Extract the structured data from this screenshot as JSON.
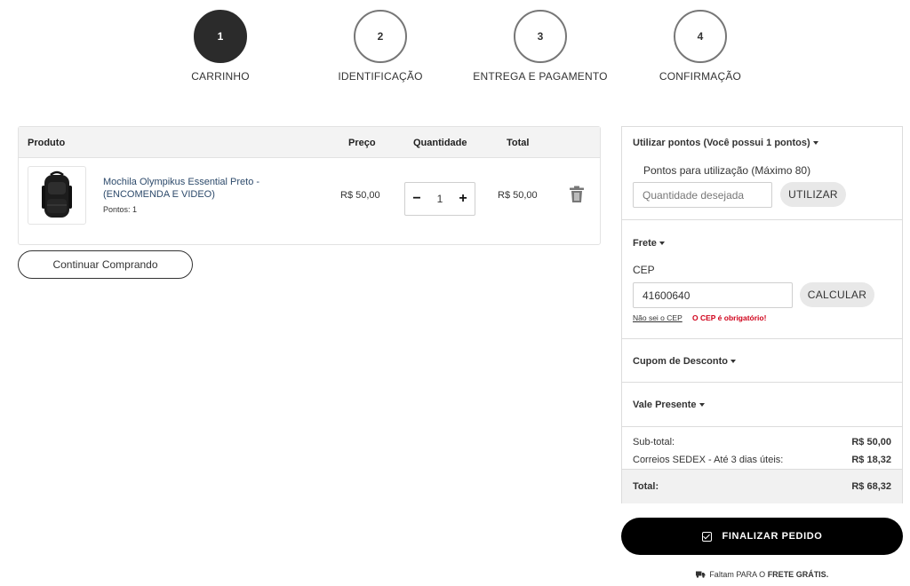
{
  "steps": [
    {
      "number": "1",
      "label": "CARRINHO"
    },
    {
      "number": "2",
      "label": "IDENTIFICAÇÃO"
    },
    {
      "number": "3",
      "label": "ENTREGA E PAGAMENTO"
    },
    {
      "number": "4",
      "label": "CONFIRMAÇÃO"
    }
  ],
  "active_step": 1,
  "cart": {
    "headers": {
      "product": "Produto",
      "price": "Preço",
      "quantity": "Quantidade",
      "total": "Total"
    },
    "item": {
      "name": "Mochila Olympikus Essential Preto - (ENCOMENDA E VIDEO)",
      "points": "Pontos: 1",
      "price": "R$ 50,00",
      "quantity": "1",
      "total": "R$ 50,00",
      "minus": "−",
      "plus": "+"
    },
    "continue_label": "Continuar Comprando"
  },
  "points": {
    "title": "Utilizar pontos (Você possui 1 pontos)",
    "label": "Pontos para utilização (Máximo 80)",
    "placeholder": "Quantidade desejada",
    "button": "UTILIZAR"
  },
  "shipping": {
    "title": "Frete",
    "cep_label": "CEP",
    "cep_value": "41600640",
    "button": "CALCULAR",
    "unknown_cep_link": "Não sei o CEP",
    "error": "O CEP é obrigatório!"
  },
  "coupon": {
    "title": "Cupom de Desconto"
  },
  "gift": {
    "title": "Vale Presente"
  },
  "summary": {
    "subtotal_label": "Sub-total:",
    "subtotal_value": "R$ 50,00",
    "shipping_label": "Correios SEDEX - Até 3 dias úteis:",
    "shipping_value": "R$ 18,32",
    "total_label": "Total:",
    "total_value": "R$ 68,32"
  },
  "finalize_label": "FINALIZAR PEDIDO",
  "free_shipping": {
    "prefix": "Faltam PARA O",
    "bold": "FRETE GRÁTIS."
  },
  "colors": {
    "accent": "#000000",
    "error": "#d0021b",
    "link": "#2d4a6b"
  }
}
